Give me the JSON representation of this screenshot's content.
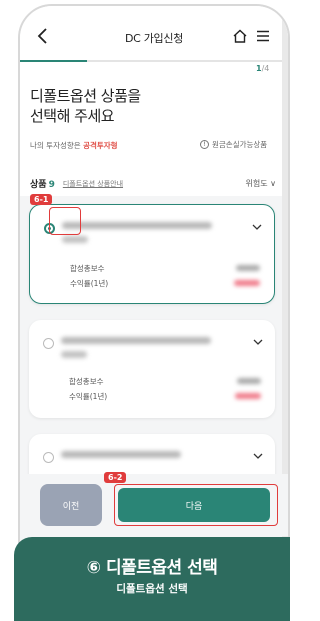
{
  "header": {
    "title": "DC 가입신청",
    "back_icon": "chevron-left-icon",
    "home_icon": "home-icon",
    "menu_icon": "hamburger-menu-icon",
    "step": "1",
    "step_total": "/4",
    "progress": 0.25
  },
  "main": {
    "heading": "디폴트옵션 상품을\n선택해 주세요",
    "invest_type_prefix": "나의 투자성향은 ",
    "invest_type_value": "공격투자형",
    "loss_note": "원금손실가능상품",
    "product_label": "상품",
    "product_count": "9",
    "product_link": "디폴트옵션 상품안내",
    "risk_sort": "위험도"
  },
  "cards": [
    {
      "selected": true,
      "fee_label": "합성총보수",
      "return_label": "수익률(1년)"
    },
    {
      "selected": false,
      "fee_label": "합성총보수",
      "return_label": "수익률(1년)"
    },
    {
      "selected": false
    }
  ],
  "buttons": {
    "prev": "이전",
    "next": "다음"
  },
  "annotations": {
    "tag1": "6-1",
    "tag2": "6-2"
  },
  "caption": {
    "title": "⑥ 디폴트옵션 선택",
    "subtitle": "디폴트옵션 선택"
  },
  "colors": {
    "accent": "#2a8576",
    "highlight": "#e03c3c",
    "caption_bg": "#2d6b5e",
    "warning_text": "#e05048"
  }
}
